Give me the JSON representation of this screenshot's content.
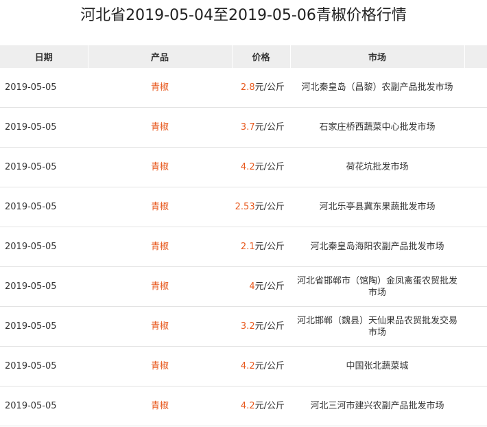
{
  "title": "河北省2019-05-04至2019-05-06青椒价格行情",
  "columns": {
    "date": "日期",
    "product": "产品",
    "price": "价格",
    "market": "市场"
  },
  "rows": [
    {
      "date": "2019-05-05",
      "product": "青椒",
      "price_value": "2.8",
      "price_unit": "元/公斤",
      "market": "河北秦皇岛（昌黎）农副产品批发市场"
    },
    {
      "date": "2019-05-05",
      "product": "青椒",
      "price_value": "3.7",
      "price_unit": "元/公斤",
      "market": "石家庄桥西蔬菜中心批发市场"
    },
    {
      "date": "2019-05-05",
      "product": "青椒",
      "price_value": "4.2",
      "price_unit": "元/公斤",
      "market": "荷花坑批发市场"
    },
    {
      "date": "2019-05-05",
      "product": "青椒",
      "price_value": "2.53",
      "price_unit": "元/公斤",
      "market": "河北乐亭县冀东果蔬批发市场"
    },
    {
      "date": "2019-05-05",
      "product": "青椒",
      "price_value": "2.1",
      "price_unit": "元/公斤",
      "market": "河北秦皇岛海阳农副产品批发市场"
    },
    {
      "date": "2019-05-05",
      "product": "青椒",
      "price_value": "4",
      "price_unit": "元/公斤",
      "market": "河北省邯郸市（馆陶）金凤禽蛋农贸批发市场"
    },
    {
      "date": "2019-05-05",
      "product": "青椒",
      "price_value": "3.2",
      "price_unit": "元/公斤",
      "market": "河北邯郸（魏县）天仙果品农贸批发交易市场"
    },
    {
      "date": "2019-05-05",
      "product": "青椒",
      "price_value": "4.2",
      "price_unit": "元/公斤",
      "market": "中国张北蔬菜城"
    },
    {
      "date": "2019-05-05",
      "product": "青椒",
      "price_value": "4.2",
      "price_unit": "元/公斤",
      "market": "河北三河市建兴农副产品批发市场"
    }
  ]
}
